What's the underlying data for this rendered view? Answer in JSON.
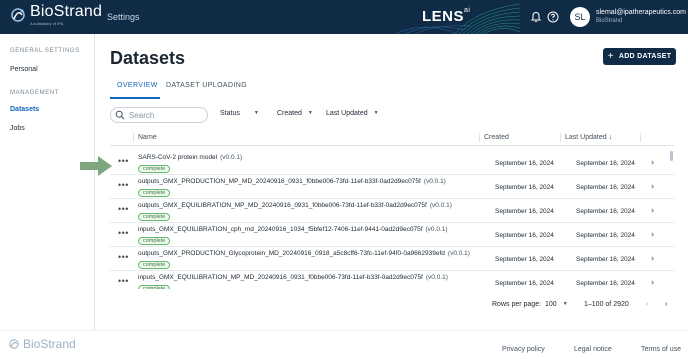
{
  "brand": {
    "name": "BioStrand",
    "subtitle": "A subsidiary of IPA",
    "section": "Settings"
  },
  "product": {
    "name": "LENS",
    "suffix": "ai"
  },
  "user": {
    "initials": "SL",
    "email": "slemal@ipatherapeutics.com",
    "org": "BioStrand"
  },
  "sidebar": {
    "general_heading": "GENERAL SETTINGS",
    "personal": "Personal",
    "management_heading": "MANAGEMENT",
    "datasets": "Datasets",
    "jobs": "Jobs"
  },
  "page": {
    "title": "Datasets",
    "add_button": "ADD DATASET"
  },
  "tabs": [
    "OVERVIEW",
    "DATASET UPLOADING"
  ],
  "filters": {
    "search_placeholder": "Search",
    "status": "Status",
    "created": "Created",
    "last_updated": "Last Updated"
  },
  "table": {
    "headers": {
      "name": "Name",
      "created": "Created",
      "last_updated": "Last Updated"
    },
    "rows": [
      {
        "name": "SARS-CoV-2 protein model",
        "version": "(v0.0.1)",
        "status": "complete",
        "created": "September 16, 2024",
        "updated": "September 16, 2024"
      },
      {
        "name": "outputs_GMX_PRODUCTION_MP_MD_20240916_0931_f0bbe006-73fd-11ef-b33f-0ad2d9ec075f",
        "version": "(v0.0.1)",
        "status": "complete",
        "created": "September 16, 2024",
        "updated": "September 16, 2024"
      },
      {
        "name": "outputs_GMX_EQUILIBRATION_MP_MD_20240916_0931_f0bbe006-73fd-11ef-b33f-0ad2d9ec075f",
        "version": "(v0.0.1)",
        "status": "complete",
        "created": "September 16, 2024",
        "updated": "September 16, 2024"
      },
      {
        "name": "inputs_GMX_EQUILIBRATION_cph_md_20240916_1034_f5bfef12-7406-11ef-9441-0ad2d9ec075f",
        "version": "(v0.0.1)",
        "status": "complete",
        "created": "September 16, 2024",
        "updated": "September 16, 2024"
      },
      {
        "name": "outputs_GMX_PRODUCTION_Glycoprotein_MD_20240916_0918_a5c8cff6-73fc-11ef-94f0-0a9662939efd",
        "version": "(v0.0.1)",
        "status": "complete",
        "created": "September 16, 2024",
        "updated": "September 16, 2024"
      },
      {
        "name": "inputs_GMX_EQUILIBRATION_MP_MD_20240916_0931_f0bbe006-73fd-11ef-b33f-0ad2d9ec075f",
        "version": "(v0.0.1)",
        "status": "complete",
        "created": "September 16, 2024",
        "updated": "September 16, 2024"
      }
    ]
  },
  "pagination": {
    "rows_label": "Rows per page:",
    "rows_value": "100",
    "range": "1–100 of 2920"
  },
  "footer": {
    "logo": "BioStrand",
    "privacy": "Privacy policy",
    "legal": "Legal notice",
    "terms": "Terms of use"
  }
}
